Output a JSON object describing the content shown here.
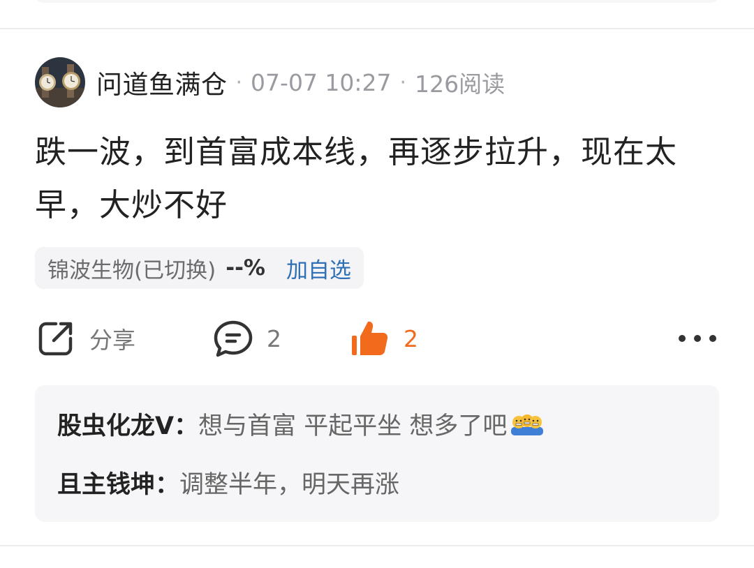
{
  "post": {
    "author": {
      "name": "问道鱼满仓",
      "avatar_icon": "avatar-watches"
    },
    "meta": {
      "date": "07-07 10:27",
      "reads": "126阅读",
      "separator": "·"
    },
    "content": "跌一波，到首富成本线，再逐步拉升，现在太早，大炒不好",
    "stock_tag": {
      "name": "锦波生物(已切换)",
      "change": "--%",
      "action": "加自选"
    },
    "actions": {
      "share": {
        "label": "分享",
        "icon": "share-icon"
      },
      "comment": {
        "count": "2",
        "icon": "comment-icon"
      },
      "like": {
        "count": "2",
        "icon": "thumbs-up-icon",
        "active": true,
        "color": "#f26b1d"
      },
      "more": {
        "icon": "more-icon"
      }
    },
    "comments": [
      {
        "user": "股虫化龙V",
        "colon": "：",
        "text": "想与首富 平起平坐 想多了吧",
        "emoji": "grimace-emoji"
      },
      {
        "user": "且主钱坤",
        "colon": "：",
        "text": "调整半年，明天再涨"
      }
    ]
  },
  "colors": {
    "accent": "#f26b1d",
    "link": "#2f6fb5",
    "muted": "#9a9aa0"
  }
}
